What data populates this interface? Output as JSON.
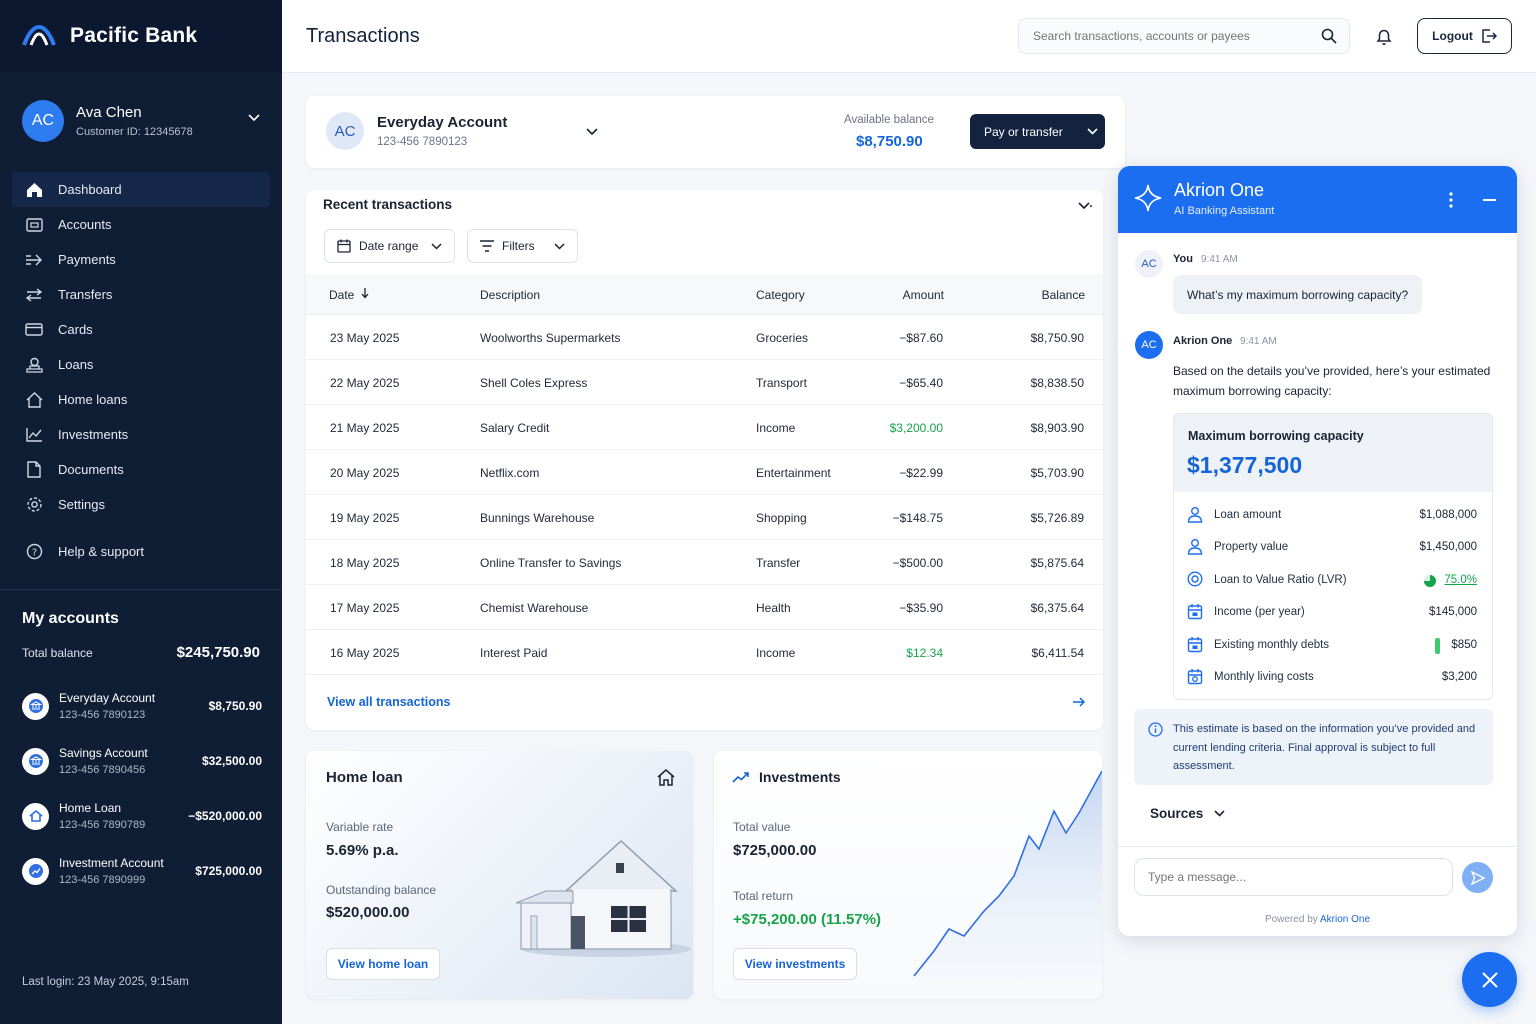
{
  "brand": {
    "name": "Pacific Bank"
  },
  "user": {
    "initials": "AC",
    "name": "Ava Chen",
    "customer_id": "Customer ID: 12345678"
  },
  "nav": [
    {
      "label": "Dashboard",
      "icon": "home-icon"
    },
    {
      "label": "Accounts",
      "icon": "accounts-icon"
    },
    {
      "label": "Payments",
      "icon": "payments-icon"
    },
    {
      "label": "Transfers",
      "icon": "transfers-icon"
    },
    {
      "label": "Cards",
      "icon": "card-icon"
    },
    {
      "label": "Loans",
      "icon": "loans-icon"
    },
    {
      "label": "Home loans",
      "icon": "home-loans-icon"
    },
    {
      "label": "Investments",
      "icon": "investments-icon"
    },
    {
      "label": "Documents",
      "icon": "document-icon"
    },
    {
      "label": "Settings",
      "icon": "gear-icon"
    }
  ],
  "help": {
    "label": "Help & support"
  },
  "my_accounts": {
    "title": "My accounts",
    "total_label": "Total balance",
    "total_value": "$245,750.90",
    "items": [
      {
        "name": "Everyday Account",
        "number": "123-456 7890123",
        "balance": "$8,750.90"
      },
      {
        "name": "Savings Account",
        "number": "123-456 7890456",
        "balance": "$32,500.00"
      },
      {
        "name": "Home Loan",
        "number": "123-456 7890789",
        "balance": "−$520,000.00"
      },
      {
        "name": "Investment Account",
        "number": "123-456 7890999",
        "balance": "$725,000.00"
      }
    ]
  },
  "last_login": "Last login: 23 May 2025, 9:15am",
  "header": {
    "title": "Transactions",
    "search_placeholder": "Search transactions, accounts or payees",
    "logout": "Logout"
  },
  "account_card": {
    "initials": "AC",
    "name": "Everyday Account",
    "number": "123-456 7890123",
    "balance_label": "Available balance",
    "balance": "$8,750.90",
    "pay_button": "Pay or transfer"
  },
  "transactions": {
    "title": "Recent transactions",
    "date_range": "Date range",
    "filters": "Filters",
    "columns": {
      "date": "Date",
      "description": "Description",
      "category": "Category",
      "amount": "Amount",
      "balance": "Balance"
    },
    "rows": [
      {
        "date": "23 May 2025",
        "description": "Woolworths Supermarkets",
        "category": "Groceries",
        "amount": "−$87.60",
        "balance": "$8,750.90",
        "type": "debit"
      },
      {
        "date": "22 May 2025",
        "description": "Shell Coles Express",
        "category": "Transport",
        "amount": "−$65.40",
        "balance": "$8,838.50",
        "type": "debit"
      },
      {
        "date": "21 May 2025",
        "description": "Salary Credit",
        "category": "Income",
        "amount": "$3,200.00",
        "balance": "$8,903.90",
        "type": "credit"
      },
      {
        "date": "20 May 2025",
        "description": "Netflix.com",
        "category": "Entertainment",
        "amount": "−$22.99",
        "balance": "$5,703.90",
        "type": "debit"
      },
      {
        "date": "19 May 2025",
        "description": "Bunnings Warehouse",
        "category": "Shopping",
        "amount": "−$148.75",
        "balance": "$5,726.89",
        "type": "debit"
      },
      {
        "date": "18 May 2025",
        "description": "Online Transfer to Savings",
        "category": "Transfer",
        "amount": "−$500.00",
        "balance": "$5,875.64",
        "type": "debit"
      },
      {
        "date": "17 May 2025",
        "description": "Chemist Warehouse",
        "category": "Health",
        "amount": "−$35.90",
        "balance": "$6,375.64",
        "type": "debit"
      },
      {
        "date": "16 May 2025",
        "description": "Interest Paid",
        "category": "Income",
        "amount": "$12.34",
        "balance": "$6,411.54",
        "type": "credit"
      }
    ],
    "view_all": "View all transactions"
  },
  "home_loan": {
    "title": "Home loan",
    "rate_label": "Variable rate",
    "rate": "5.69% p.a.",
    "outstanding_label": "Outstanding balance",
    "outstanding": "$520,000.00",
    "button": "View home loan"
  },
  "investments": {
    "title": "Investments",
    "total_label": "Total value",
    "total": "$725,000.00",
    "return_label": "Total return",
    "return": "+$75,200.00 (11.57%)",
    "button": "View investments"
  },
  "chat": {
    "title": "Akrion One",
    "subtitle": "AI Banking Assistant",
    "user_initials": "AC",
    "user_name": "You",
    "user_time": "9:41 AM",
    "user_message": "What’s my maximum borrowing capacity?",
    "bot_initials": "AC",
    "bot_name": "Akrion One",
    "bot_time": "9:41 AM",
    "bot_message": "Based on the details you’ve provided, here’s your estimated maximum borrowing capacity:",
    "capacity_label": "Maximum borrowing capacity",
    "capacity_value": "$1,377,500",
    "details": [
      {
        "label": "Loan amount",
        "value": "$1,088,000",
        "icon": "person-icon"
      },
      {
        "label": "Property value",
        "value": "$1,450,000",
        "icon": "person-icon"
      },
      {
        "label": "Loan to Value Ratio (LVR)",
        "value": "75.0%",
        "icon": "target-icon"
      },
      {
        "label": "Income (per year)",
        "value": "$145,000",
        "icon": "calendar-icon"
      },
      {
        "label": "Existing monthly debts",
        "value": "$850",
        "icon": "calendar-icon"
      },
      {
        "label": "Monthly living costs",
        "value": "$3,200",
        "icon": "calendar-icon"
      }
    ],
    "lvr_fraction": 0.75,
    "disclaimer": "This estimate is based on the information you’ve provided and current lending criteria. Final approval is subject to full assessment.",
    "sources": "Sources",
    "input_placeholder": "Type a message...",
    "powered_prefix": "Powered by",
    "powered_brand": "Akrion One"
  },
  "colors": {
    "accent": "#1b6ef0",
    "navy": "#0f1d35",
    "positive": "#16a34a",
    "link": "#1565d8"
  }
}
